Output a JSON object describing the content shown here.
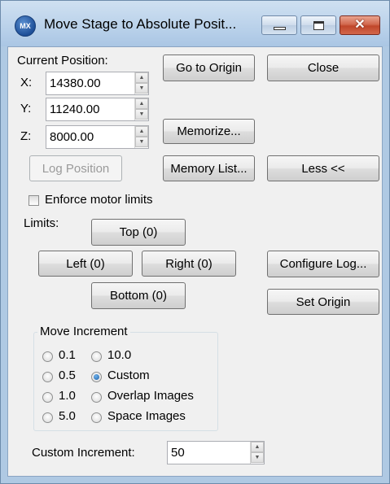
{
  "window": {
    "title": "Move Stage to Absolute Posit...",
    "icon_text": "MX"
  },
  "position": {
    "label": "Current Position:",
    "x_label": "X:",
    "x_value": "14380.00",
    "y_label": "Y:",
    "y_value": "11240.00",
    "z_label": "Z:",
    "z_value": "8000.00"
  },
  "buttons": {
    "go_to_origin": "Go to Origin",
    "close": "Close",
    "memorize": "Memorize...",
    "log_position": "Log Position",
    "memory_list": "Memory List...",
    "less": "Less <<",
    "top": "Top (0)",
    "left": "Left (0)",
    "right": "Right (0)",
    "bottom": "Bottom (0)",
    "configure_log": "Configure Log...",
    "set_origin": "Set Origin"
  },
  "limits": {
    "enforce_label": "Enforce motor limits",
    "enforce_checked": false,
    "label": "Limits:"
  },
  "increment": {
    "group_title": "Move Increment",
    "options": [
      "0.1",
      "10.0",
      "0.5",
      "Custom",
      "1.0",
      "Overlap Images",
      "5.0",
      "Space Images"
    ],
    "selected": "Custom",
    "custom_label": "Custom Increment:",
    "custom_value": "50"
  },
  "icons": {
    "app": "mx-app-icon",
    "minimize": "minimize-icon",
    "maximize": "maximize-icon",
    "close": "close-icon"
  }
}
